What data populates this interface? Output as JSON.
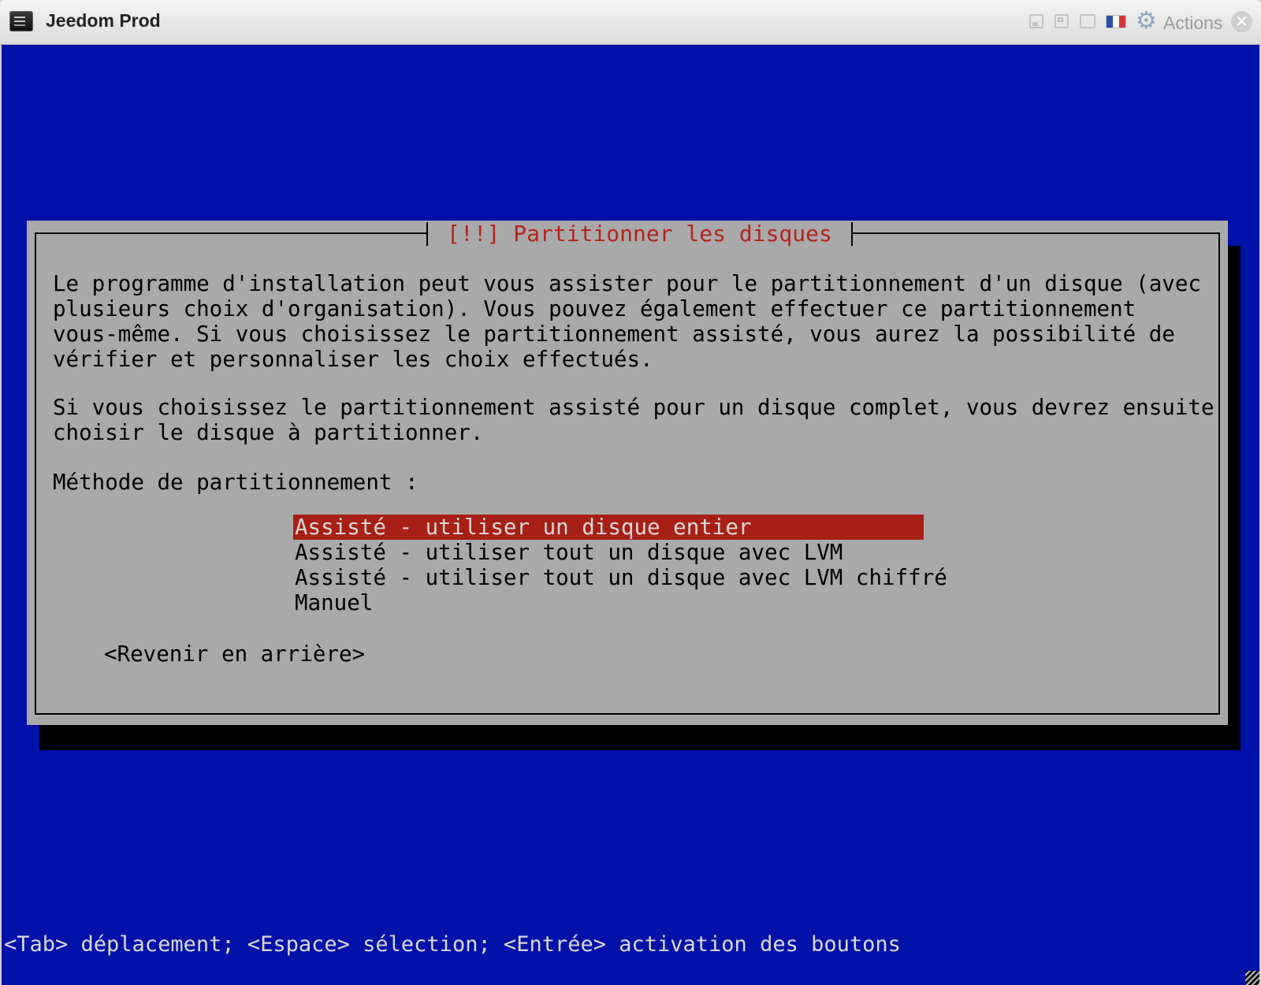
{
  "window": {
    "title": "Jeedom Prod",
    "actions_label": "Actions",
    "icons": [
      "app-terminal-icon",
      "minimize-icon",
      "restore-icon",
      "maximize-icon",
      "french-flag-icon",
      "gear-icon",
      "close-icon"
    ],
    "flag_colors": [
      "#2a4fa8",
      "#f6f6f6",
      "#d8333a"
    ],
    "close_glyph": "✕",
    "gear_glyph": "⚙"
  },
  "screen": {
    "background": "#0012a8"
  },
  "dialog": {
    "title": "[!!] Partitionner les disques",
    "paragraph_1": "Le programme d'installation peut vous assister pour le partitionnement d'un disque (avec\nplusieurs choix d'organisation). Vous pouvez également effectuer ce partitionnement\nvous-même. Si vous choisissez le partitionnement assisté, vous aurez la possibilité de\nvérifier et personnaliser les choix effectués.",
    "paragraph_2": "Si vous choisissez le partitionnement assisté pour un disque complet, vous devrez ensuite\nchoisir le disque à partitionner.",
    "prompt": "Méthode de partitionnement :",
    "options": [
      {
        "label": "Assisté - utiliser un disque entier",
        "selected": true
      },
      {
        "label": "Assisté - utiliser tout un disque avec LVM",
        "selected": false
      },
      {
        "label": "Assisté - utiliser tout un disque avec LVM chiffré",
        "selected": false
      },
      {
        "label": "Manuel",
        "selected": false
      }
    ],
    "back_button": "<Revenir en arrière>",
    "highlight_color": "#a81f16",
    "title_color": "#b3241a"
  },
  "status_bar": "<Tab> déplacement; <Espace> sélection; <Entrée> activation des boutons"
}
